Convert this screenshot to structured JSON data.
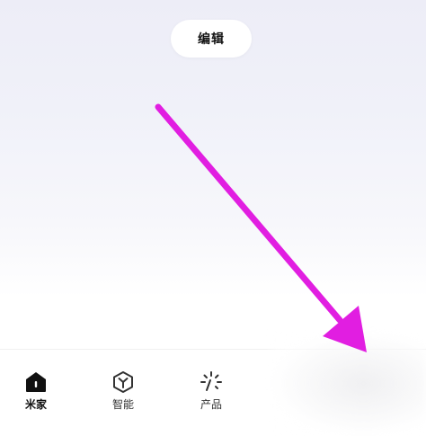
{
  "header": {
    "edit_label": "编辑"
  },
  "tabs": [
    {
      "label": "米家",
      "icon": "home-icon",
      "active": true
    },
    {
      "label": "智能",
      "icon": "hexagon-y-icon",
      "active": false
    },
    {
      "label": "产品",
      "icon": "sparkle-icon",
      "active": false
    }
  ],
  "annotation": {
    "arrow_color": "#e11ee1"
  }
}
